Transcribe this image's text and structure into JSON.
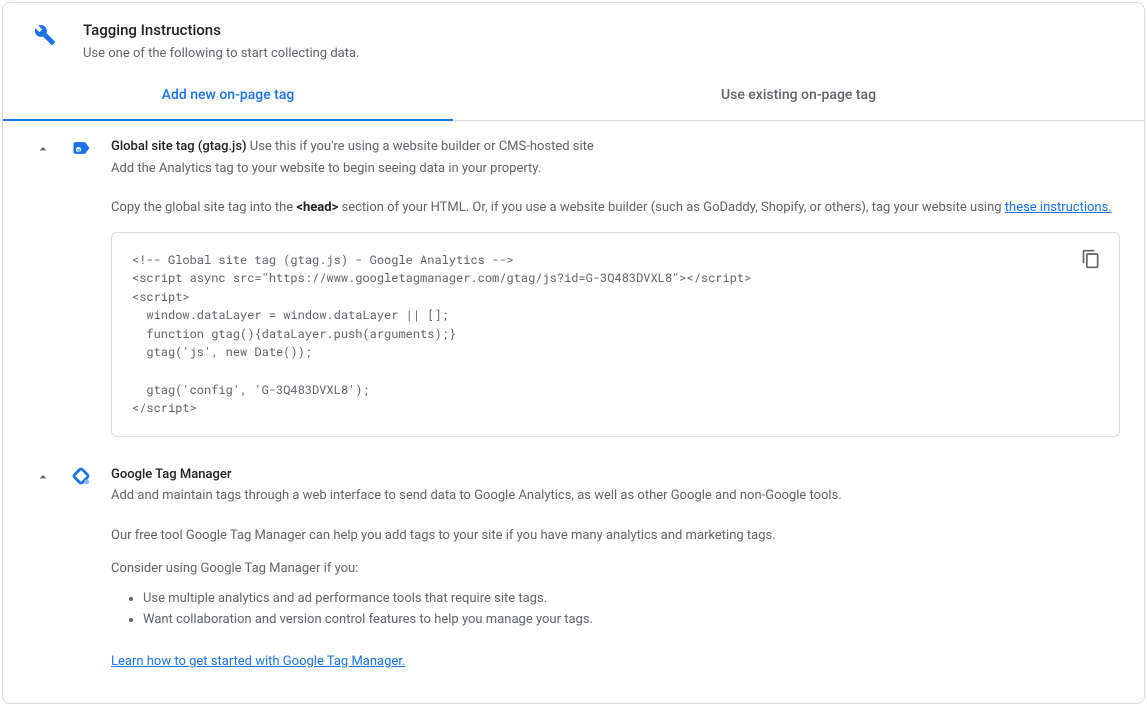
{
  "header": {
    "title": "Tagging Instructions",
    "subtitle": "Use one of the following to start collecting data."
  },
  "tabs": {
    "add_new": "Add new on-page tag",
    "use_existing": "Use existing on-page tag"
  },
  "gtag": {
    "title": "Global site tag (gtag.js)",
    "title_suffix": " Use this if you're using a website builder or CMS-hosted site",
    "subtitle": "Add the Analytics tag to your website to begin seeing data in your property.",
    "instr_prefix": "Copy the global site tag into the ",
    "instr_head": "<head>",
    "instr_mid": " section of your HTML. Or, if you use a website builder (such as GoDaddy, Shopify, or others), tag your website using ",
    "instr_link": "these instructions.",
    "code": "<!-- Global site tag (gtag.js) - Google Analytics -->\n<script async src=\"https://www.googletagmanager.com/gtag/js?id=G-3Q483DVXL8\"></script>\n<script>\n  window.dataLayer = window.dataLayer || [];\n  function gtag(){dataLayer.push(arguments);}\n  gtag('js', new Date());\n\n  gtag('config', 'G-3Q483DVXL8');\n</script>"
  },
  "gtm": {
    "title": "Google Tag Manager",
    "subtitle": "Add and maintain tags through a web interface to send data to Google Analytics, as well as other Google and non-Google tools.",
    "para1": "Our free tool Google Tag Manager can help you add tags to your site if you have many analytics and marketing tags.",
    "para2": "Consider using Google Tag Manager if you:",
    "bullets": [
      "Use multiple analytics and ad performance tools that require site tags.",
      "Want collaboration and version control features to help you manage your tags."
    ],
    "learn_link": "Learn how to get started with Google Tag Manager."
  }
}
